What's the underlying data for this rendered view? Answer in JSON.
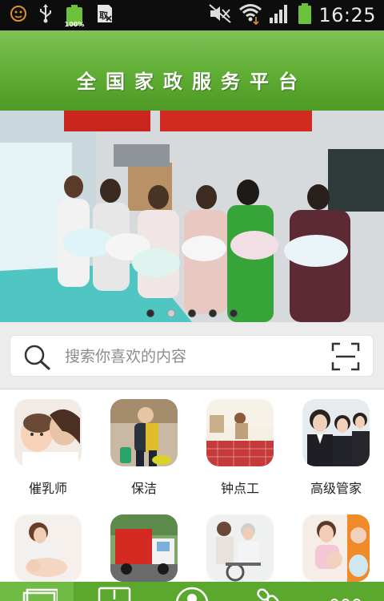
{
  "status_bar": {
    "time": "16:25",
    "battery_percent": "100%",
    "icons": [
      "face-icon",
      "usb-icon",
      "battery-icon",
      "sd-card-icon",
      "mute-icon",
      "wifi-icon",
      "signal-icon",
      "battery-full-icon"
    ]
  },
  "header": {
    "title": "全国家政服务平台"
  },
  "banner": {
    "slide_count": 5,
    "active_index": 1
  },
  "search": {
    "placeholder": "搜索你喜欢的内容"
  },
  "categories": [
    {
      "label": "催乳师"
    },
    {
      "label": "保洁"
    },
    {
      "label": "钟点工"
    },
    {
      "label": "高级管家"
    },
    {
      "label": ""
    },
    {
      "label": ""
    },
    {
      "label": ""
    },
    {
      "label": ""
    }
  ],
  "bottom_tabs": [
    "home-tab-icon",
    "download-tab-icon",
    "user-tab-icon",
    "link-tab-icon",
    "more-tab-icon"
  ],
  "colors": {
    "header_green": "#5fad33",
    "bottom_green": "#5aa82e",
    "status_bar": "#0d0d0d"
  }
}
